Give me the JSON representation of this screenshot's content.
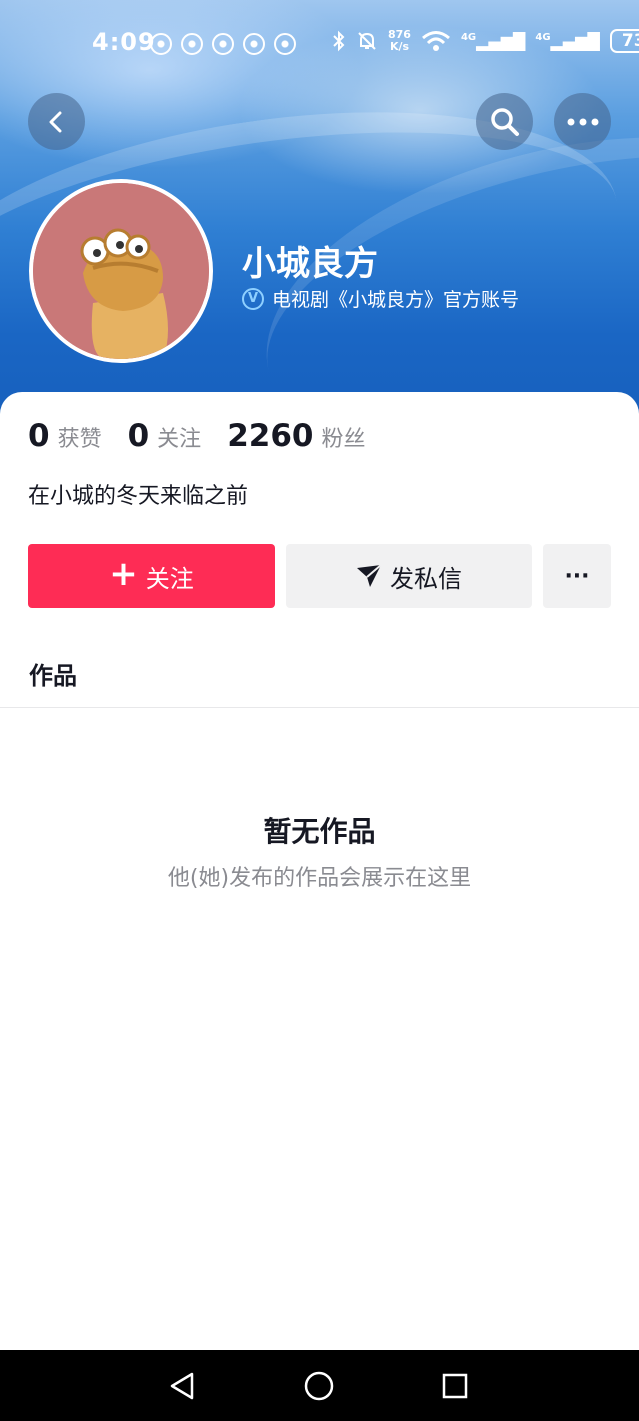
{
  "status_bar": {
    "time": "4:09",
    "net_speed_value": "876",
    "net_speed_unit": "K/s",
    "signal1": "4G",
    "signal2": "4G",
    "battery": "73"
  },
  "profile": {
    "name": "小城良方",
    "verified_text": "电视剧《小城良方》官方账号",
    "verify_badge": "V",
    "bio": "在小城的冬天来临之前"
  },
  "stats": [
    {
      "value": "0",
      "label": "获赞"
    },
    {
      "value": "0",
      "label": "关注"
    },
    {
      "value": "2260",
      "label": "粉丝"
    }
  ],
  "actions": {
    "follow_icon": "+",
    "follow_label": "关注",
    "message_label": "发私信",
    "more_label": "···"
  },
  "tabs": {
    "works_label": "作品"
  },
  "empty_state": {
    "title": "暂无作品",
    "subtitle": "他(她)发布的作品会展示在这里"
  },
  "colors": {
    "accent": "#fe2c55",
    "hero_blue": "#2f7fd3",
    "muted_text": "#8a8b91"
  },
  "icons": {
    "back": "chevron-left-icon",
    "search": "search-icon",
    "more": "more-dots-icon",
    "send": "send-icon"
  }
}
